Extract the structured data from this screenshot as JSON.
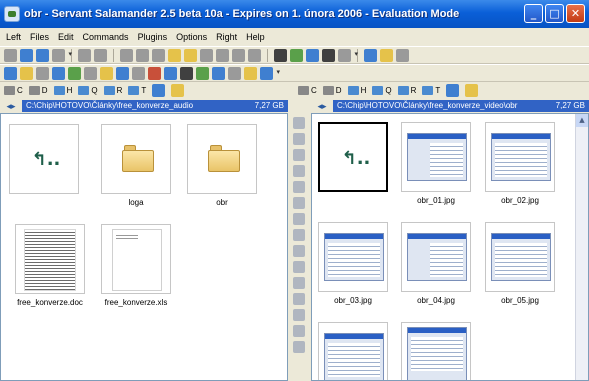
{
  "window": {
    "title": "obr - Servant Salamander 2.5 beta 10a - Expires on 1. února 2006 - Evaluation Mode",
    "buttons": {
      "minimize": "_",
      "maximize": "□",
      "close": "✕"
    }
  },
  "menu": [
    "Left",
    "Files",
    "Edit",
    "Commands",
    "Plugins",
    "Options",
    "Right",
    "Help"
  ],
  "drive_bars": {
    "left": [
      {
        "label": "C"
      },
      {
        "label": "D"
      },
      {
        "label": "H"
      },
      {
        "label": "Q"
      },
      {
        "label": "R"
      },
      {
        "label": "T"
      }
    ],
    "right": [
      {
        "label": "C"
      },
      {
        "label": "D"
      },
      {
        "label": "H"
      },
      {
        "label": "Q"
      },
      {
        "label": "R"
      },
      {
        "label": "T"
      }
    ]
  },
  "left_panel": {
    "path": "C:\\Chip\\HOTOVO\\Články\\free_konverze_audio",
    "free_space": "7,27 GB",
    "items": [
      {
        "name": "",
        "type": "up"
      },
      {
        "name": "loga",
        "type": "folder"
      },
      {
        "name": "obr",
        "type": "folder"
      },
      {
        "name": "free_konverze.doc",
        "type": "doc"
      },
      {
        "name": "free_konverze.xls",
        "type": "xls"
      }
    ]
  },
  "right_panel": {
    "path": "C:\\Chip\\HOTOVO\\Články\\free_konverze_video\\obr",
    "free_space": "7,27 GB",
    "items": [
      {
        "name": "",
        "type": "up"
      },
      {
        "name": "obr_01.jpg",
        "type": "image"
      },
      {
        "name": "obr_02.jpg",
        "type": "image"
      },
      {
        "name": "obr_03.jpg",
        "type": "image"
      },
      {
        "name": "obr_04.jpg",
        "type": "image"
      },
      {
        "name": "obr_05.jpg",
        "type": "image"
      },
      {
        "name": "",
        "type": "image"
      },
      {
        "name": "",
        "type": "image"
      }
    ]
  },
  "colors": {
    "titlebar": "#0a5fd8",
    "path_active": "#3163c5",
    "window_bg": "#ece9d8"
  }
}
